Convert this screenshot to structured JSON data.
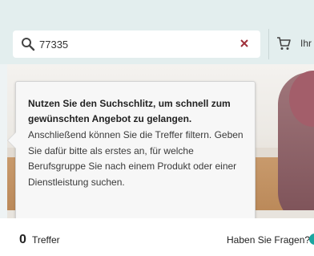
{
  "search": {
    "value": "77335",
    "icon": "search-icon",
    "clear_icon": "close-icon"
  },
  "header": {
    "cart_icon": "cart-icon",
    "cart_label": "Ihr"
  },
  "tooltip": {
    "title": "Nutzen Sie den Suchschlitz, um schnell zum gewünschten Angebot zu gelangen.",
    "body": "Anschließend können Sie die Treffer filtern. Geben Sie dafür bitte als erstes an, für welche Berufsgruppe Sie nach einem Produkt oder einer Dienstleistung suchen."
  },
  "results": {
    "count": "0",
    "label": "Treffer"
  },
  "help": {
    "label": "Haben Sie Fragen?"
  },
  "colors": {
    "accent": "#1aa6a0",
    "clear_icon": "#a0303a",
    "header_bg": "#e3eeee"
  }
}
